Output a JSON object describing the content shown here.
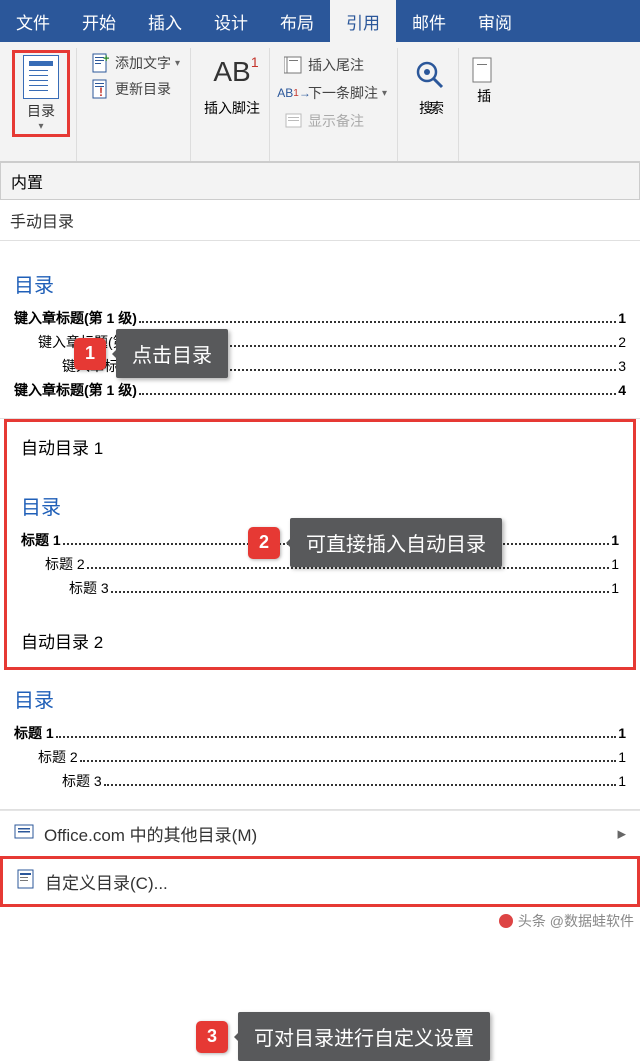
{
  "tabs": [
    "文件",
    "开始",
    "插入",
    "设计",
    "布局",
    "引用",
    "邮件",
    "审阅"
  ],
  "active_tab_index": 5,
  "ribbon": {
    "toc_label": "目录",
    "add_text": "添加文字",
    "update_toc": "更新目录",
    "insert_footnote": "插入脚注",
    "insert_endnote": "插入尾注",
    "next_footnote": "下一条脚注",
    "show_notes": "显示备注",
    "search": "搜索",
    "insert_partial": "插"
  },
  "dropdown": {
    "builtin": "内置",
    "manual": "手动目录",
    "toc_header": "目录",
    "manual_lines": [
      {
        "level": 1,
        "text": "键入章标题(第 1 级)",
        "page": "1"
      },
      {
        "level": 2,
        "text": "键入章标题(第 2 级)",
        "page": "2"
      },
      {
        "level": 3,
        "text": "键入章标题(第 3 级)",
        "page": "3"
      },
      {
        "level": 1,
        "text": "键入章标题(第 1 级)",
        "page": "4"
      }
    ],
    "auto1": "自动目录 1",
    "auto2": "自动目录 2",
    "auto_lines": [
      {
        "level": 1,
        "text": "标题 1",
        "page": "1"
      },
      {
        "level": 2,
        "text": "标题 2",
        "page": "1"
      },
      {
        "level": 3,
        "text": "标题 3",
        "page": "1"
      }
    ],
    "office_more": "Office.com 中的其他目录(M)",
    "custom": "自定义目录(C)..."
  },
  "annotations": {
    "a1": {
      "num": "1",
      "text": "点击目录"
    },
    "a2": {
      "num": "2",
      "text": "可直接插入自动目录"
    },
    "a3": {
      "num": "3",
      "text": "可对目录进行自定义设置"
    }
  },
  "watermark": "头条 @数据蛙软件"
}
